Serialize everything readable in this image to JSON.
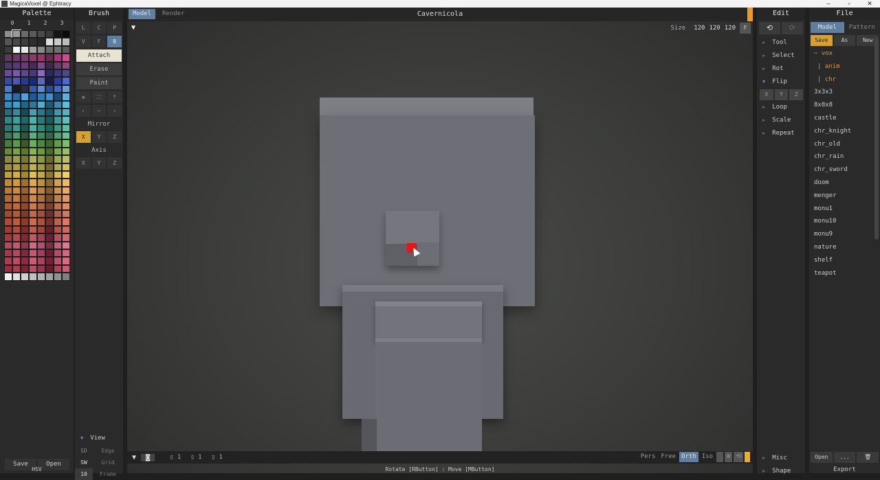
{
  "window": {
    "title": "MagicaVoxel @ Ephtracy"
  },
  "palette": {
    "header": "Palette",
    "tabs": [
      "0",
      "1",
      "2",
      "3"
    ],
    "colors": [
      "#8c8c8c",
      "#9b9b9b",
      "#6a6a6a",
      "#5a5a5a",
      "#4a4a4a",
      "#3a3a3a",
      "#151515",
      "#0a0a0a",
      "#555555",
      "#484848",
      "#3c3c3c",
      "#2e2e2e",
      "#282828",
      "#dddddd",
      "#c9c9c9",
      "#bcbcbc",
      "#3b3b3b",
      "#f4f4f4",
      "#e6e6e6",
      "#a0a0a0",
      "#8a8a8a",
      "#6a6a6a",
      "#707070",
      "#5a5a5a",
      "#5a3a5a",
      "#6b3a6b",
      "#7a3a6a",
      "#8a3a6a",
      "#a0306a",
      "#6a2a4a",
      "#b03080",
      "#d04a90",
      "#4a3a6a",
      "#5a3a7a",
      "#6a3a7a",
      "#4a2a5a",
      "#7a4a8a",
      "#3a2a4a",
      "#6a3a6a",
      "#8a4a7a",
      "#6a4a9a",
      "#7a5aaa",
      "#5a4a8a",
      "#4a3a7a",
      "#8a6aba",
      "#2a2a5a",
      "#3a3a7a",
      "#4a4a8a",
      "#3a4aa0",
      "#4a5ab0",
      "#2a3a90",
      "#1a2a7a",
      "#5a6ac0",
      "#1a1a4a",
      "#2a3aa0",
      "#4a6ad0",
      "#4a7ad0",
      "#1a1a1a",
      "#2a2a3a",
      "#3a5ab0",
      "#5a8ad0",
      "#2a4a9a",
      "#3a6ac0",
      "#6a9ae0",
      "#3a8ad0",
      "#2a6ab0",
      "#4aa0e0",
      "#1a5a9a",
      "#2a7ac0",
      "#3a90d0",
      "#1a4a7a",
      "#5ab0e0",
      "#2a90c0",
      "#3aa0d0",
      "#1a6a8a",
      "#2a7a9a",
      "#4ab0d0",
      "#1a5a7a",
      "#3a8ab0",
      "#5ac0e0",
      "#2a6a7a",
      "#3a8a9a",
      "#1a4a5a",
      "#4aa0b0",
      "#2a7a8a",
      "#1a5a6a",
      "#3a9aaa",
      "#5ab0c0",
      "#2a8a8a",
      "#3aa0a0",
      "#1a6a6a",
      "#4ab0b0",
      "#2a7a7a",
      "#1a5a5a",
      "#3a9a9a",
      "#5ac0c0",
      "#2a7a6a",
      "#3a9a8a",
      "#1a5a4a",
      "#4ab0a0",
      "#2a8a7a",
      "#1a6a5a",
      "#3a9a80",
      "#5ac0a0",
      "#3a7a5a",
      "#4a9a6a",
      "#2a5a3a",
      "#5ab080",
      "#3a8a5a",
      "#2a6a4a",
      "#4aa070",
      "#6ac090",
      "#4a7a3a",
      "#5a9a4a",
      "#3a5a2a",
      "#6ab05a",
      "#4a8a3a",
      "#3a6a2a",
      "#5aa04a",
      "#7ac06a",
      "#6a8a3a",
      "#7aa04a",
      "#5a7a2a",
      "#8ab05a",
      "#6a9a3a",
      "#4a6a2a",
      "#7aaa4a",
      "#9ac060",
      "#8a8a3a",
      "#9aa04a",
      "#7a7a2a",
      "#aab05a",
      "#8a9a3a",
      "#6a6a2a",
      "#9aaa4a",
      "#bac060",
      "#a09030",
      "#b0a040",
      "#8a7a2a",
      "#c0b050",
      "#a09a3a",
      "#7a6a2a",
      "#b0aa4a",
      "#d0c060",
      "#c0a030",
      "#d0b040",
      "#a08a2a",
      "#e0c050",
      "#c0a83a",
      "#8a7a2a",
      "#d0b84a",
      "#f0d060",
      "#c08a30",
      "#d09a3a",
      "#a0702a",
      "#e0aa4a",
      "#c0903a",
      "#8a6a2a",
      "#d0a04a",
      "#f0b860",
      "#c07a30",
      "#d08a3a",
      "#a0602a",
      "#e09a4a",
      "#c0803a",
      "#8a5a2a",
      "#d0904a",
      "#f0a860",
      "#b06a30",
      "#c07a3a",
      "#90502a",
      "#d08a4a",
      "#b0703a",
      "#7a4a2a",
      "#c0804a",
      "#e09860",
      "#b05a30",
      "#c06a3a",
      "#904a2a",
      "#d07a4a",
      "#b0603a",
      "#7a402a",
      "#c0704a",
      "#e08860",
      "#a04a30",
      "#b05a3a",
      "#803a2a",
      "#c06a4a",
      "#a0503a",
      "#6a302a",
      "#b0604a",
      "#d07860",
      "#b04a30",
      "#c05a3a",
      "#903a2a",
      "#d06a4a",
      "#b0503a",
      "#7a302a",
      "#c0604a",
      "#e07860",
      "#a03a30",
      "#b04a3a",
      "#802a2a",
      "#c05a4a",
      "#a0403a",
      "#6a202a",
      "#b0504a",
      "#d06860",
      "#a03a40",
      "#b04a50",
      "#802a30",
      "#c05a60",
      "#a04050",
      "#6a2030",
      "#b05060",
      "#d06870",
      "#b04a60",
      "#c05a70",
      "#903a50",
      "#d06a80",
      "#b05070",
      "#7a3040",
      "#c06078",
      "#e07890",
      "#a03a50",
      "#b04a60",
      "#802a40",
      "#c05a70",
      "#a04060",
      "#6a2030",
      "#b05068",
      "#d06880",
      "#b03a50",
      "#c04a60",
      "#902a40",
      "#d05a70",
      "#b04060",
      "#7a2030",
      "#c05068",
      "#e06880",
      "#a02a40",
      "#b03a50",
      "#802030",
      "#c04a60",
      "#a03050",
      "#6a1a28",
      "#b04058",
      "#d05870",
      "#f0f0f0",
      "#e0e0e0",
      "#d0d0d0",
      "#c0c0c0",
      "#b0b0b0",
      "#a0a0a0",
      "#909090",
      "#808080"
    ],
    "save": "Save",
    "open": "Open",
    "hsv": "HSV"
  },
  "brush": {
    "header": "Brush",
    "row1": [
      "L",
      "C",
      "P"
    ],
    "row2": [
      "V",
      "F",
      "B"
    ],
    "modes": [
      "Attach",
      "Erase",
      "Paint"
    ],
    "row3": [
      "✥",
      "⛶",
      "⤒"
    ],
    "row4": [
      "‹",
      "–",
      "›"
    ],
    "mirror_label": "Mirror",
    "mirror": [
      "X",
      "Y",
      "Z"
    ],
    "axis_label": "Axis",
    "axis": [
      "X",
      "Y",
      "Z"
    ],
    "view_label": "View",
    "view_rows": [
      {
        "k": "SD",
        "v": "Edge"
      },
      {
        "k": "SW",
        "v": "Grid"
      },
      {
        "k": "10",
        "v": "Frame"
      }
    ]
  },
  "viewport": {
    "tab_model": "Model",
    "tab_render": "Render",
    "title": "Cavernicola",
    "size_label": "Size",
    "size_values": [
      "120",
      "120",
      "120"
    ],
    "f_button": "F",
    "counters": [
      "1",
      "1",
      "1"
    ],
    "modes": [
      "Pers",
      "Free",
      "Orth",
      "Iso"
    ],
    "active_mode": "Orth",
    "hint": "Rotate [RButton] : Move [MButton]"
  },
  "edit": {
    "header": "Edit",
    "undo": "⟲",
    "redo": "⟳",
    "tools": [
      "Tool",
      "Select",
      "Rot",
      "Flip",
      "Loop",
      "Scale",
      "Repeat"
    ],
    "flip_axes": [
      "X",
      "Y",
      "Z"
    ],
    "bottom": [
      "Misc",
      "Shape"
    ]
  },
  "file": {
    "header": "File",
    "tab_model": "Model",
    "tab_pattern": "Pattern",
    "actions": [
      "Save",
      "As",
      "New"
    ],
    "folders": [
      "~ vox",
      "| anim",
      "| chr"
    ],
    "items": [
      "3x3x3",
      "8x8x8",
      "castle",
      "chr_knight",
      "chr_old",
      "chr_rain",
      "chr_sword",
      "doom",
      "menger",
      "monu1",
      "monu10",
      "monu9",
      "nature",
      "shelf",
      "teapot"
    ],
    "bottom": [
      "Open",
      "...",
      "🗑"
    ],
    "export": "Export"
  }
}
